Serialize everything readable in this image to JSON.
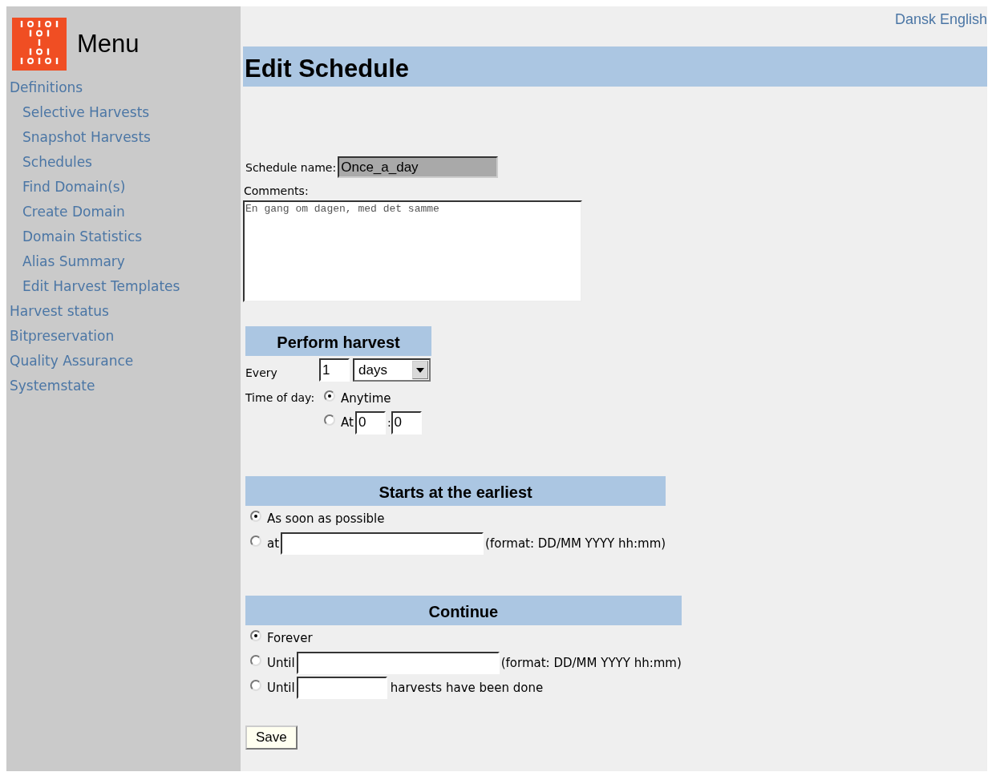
{
  "languages": [
    {
      "label": "Dansk"
    },
    {
      "label": "English"
    }
  ],
  "menu": {
    "title": "Menu",
    "items": [
      {
        "label": "Definitions",
        "children": [
          {
            "label": "Selective Harvests"
          },
          {
            "label": "Snapshot Harvests"
          },
          {
            "label": "Schedules"
          },
          {
            "label": "Find Domain(s)"
          },
          {
            "label": "Create Domain"
          },
          {
            "label": "Domain Statistics"
          },
          {
            "label": "Alias Summary"
          },
          {
            "label": "Edit Harvest Templates"
          }
        ]
      },
      {
        "label": "Harvest status"
      },
      {
        "label": "Bitpreservation"
      },
      {
        "label": "Quality Assurance"
      },
      {
        "label": "Systemstate"
      }
    ]
  },
  "page_title": "Edit Schedule",
  "schedule_name": {
    "label": "Schedule name:",
    "value": "Once_a_day"
  },
  "comments": {
    "label": "Comments:",
    "value": "En gang om dagen, med det samme"
  },
  "perform_harvest": {
    "title": "Perform harvest",
    "every_label": "Every",
    "interval": "1",
    "unit": "days",
    "time_label": "Time of day:",
    "options": [
      {
        "kind": "plain",
        "label": "Anytime",
        "selected": true
      },
      {
        "kind": "time",
        "label": "At",
        "hour": "0",
        "separator": ":",
        "minute": "0",
        "selected": false
      }
    ]
  },
  "starts": {
    "title": "Starts at the earliest",
    "options": [
      {
        "kind": "plain",
        "label": "As soon as possible",
        "selected": true
      },
      {
        "kind": "date",
        "label": "at",
        "hint": "(format: DD/MM YYYY hh:mm)",
        "selected": false
      }
    ]
  },
  "continue": {
    "title": "Continue",
    "options": [
      {
        "kind": "plain",
        "label": "Forever",
        "selected": true
      },
      {
        "kind": "date",
        "label": "Until",
        "hint": "(format: DD/MM YYYY hh:mm)",
        "selected": false
      },
      {
        "kind": "count",
        "label": "Until",
        "suffix": "harvests have been done",
        "selected": false
      }
    ]
  },
  "save_button": "Save"
}
